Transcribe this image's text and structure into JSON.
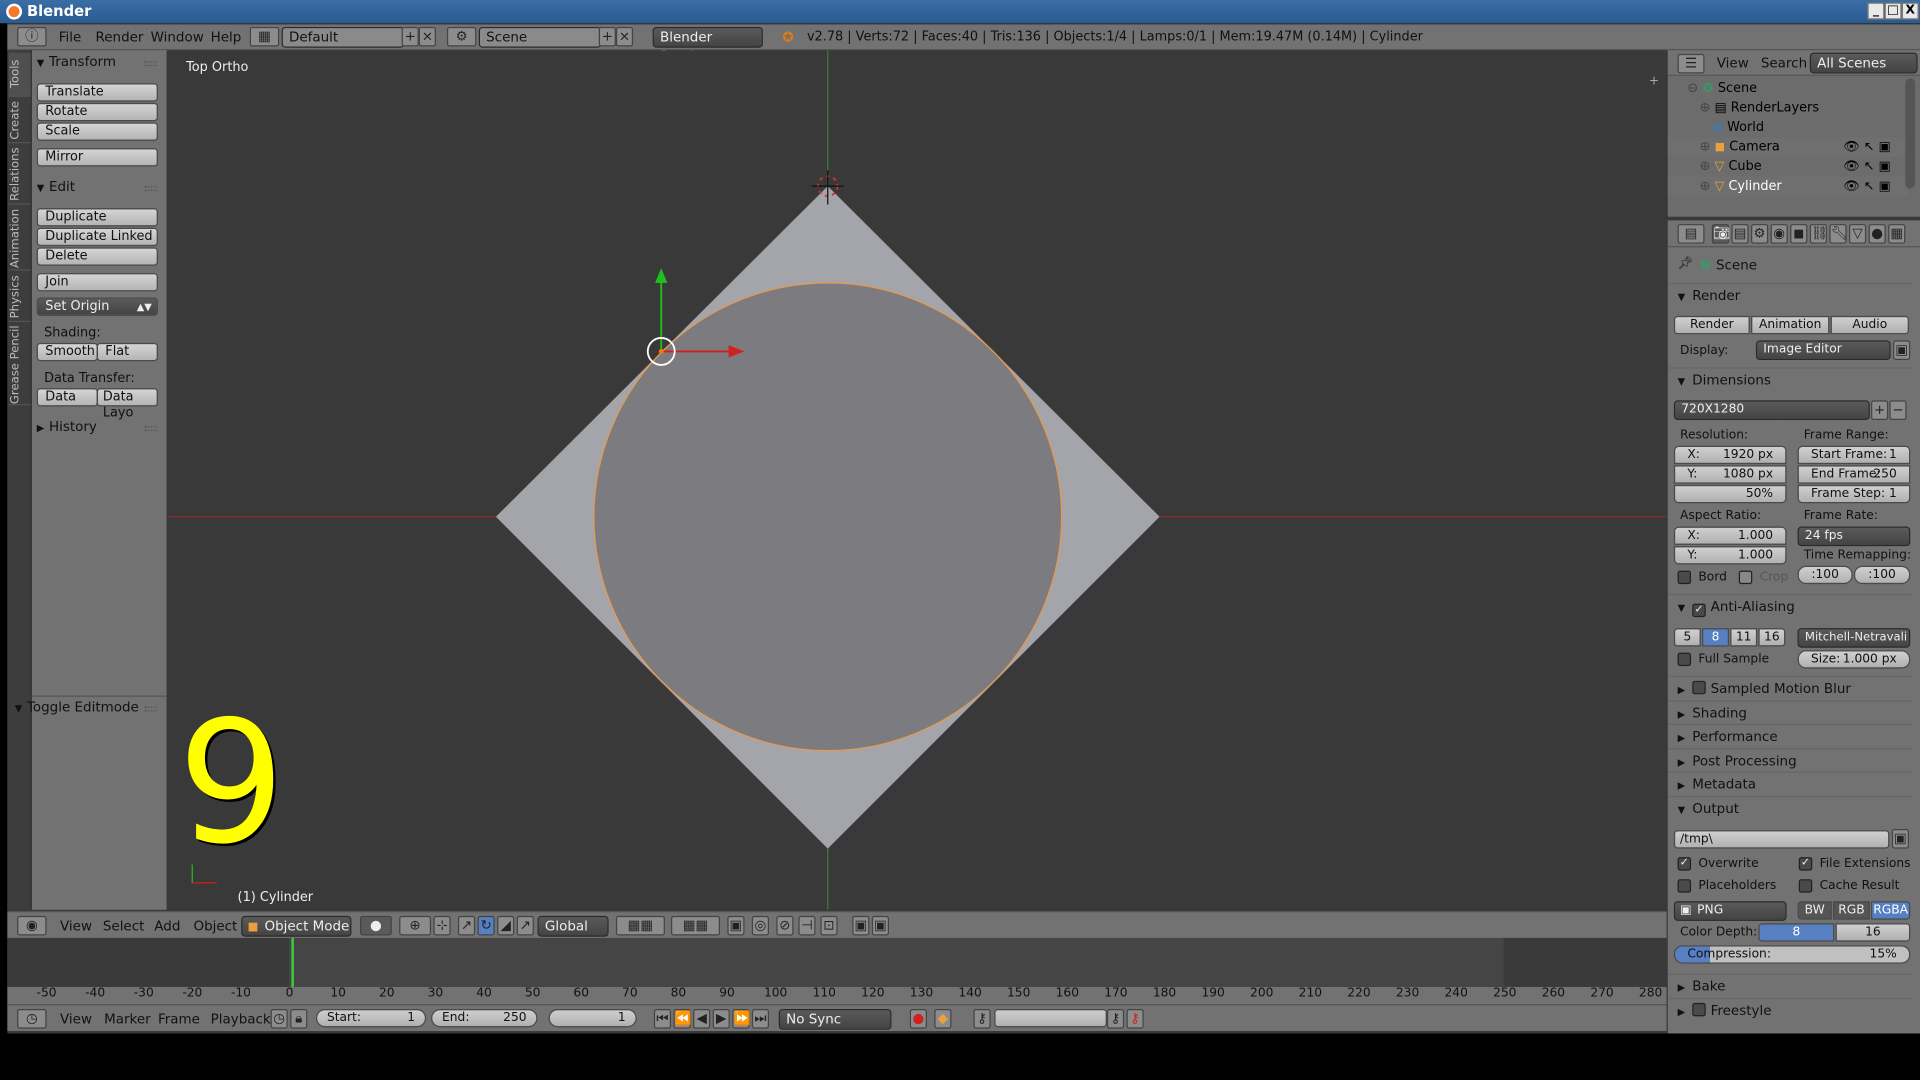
{
  "window": {
    "title": "Blender",
    "min": "_",
    "max": "□",
    "close": "X"
  },
  "menu": {
    "file": "File",
    "render": "Render",
    "window": "Window",
    "help": "Help"
  },
  "header": {
    "layout": "Default",
    "scene": "Scene",
    "engine": "Blender Render",
    "info": "v2.78 | Verts:72 | Faces:40 | Tris:136 | Objects:1/4 | Lamps:0/1 | Mem:19.47M (0.14M) | Cylinder"
  },
  "tabs": [
    "Tools",
    "Create",
    "Relations",
    "Animation",
    "Physics",
    "Grease Pencil"
  ],
  "tools": {
    "transform": "Transform",
    "translate": "Translate",
    "rotate": "Rotate",
    "scale": "Scale",
    "mirror": "Mirror",
    "edit": "Edit",
    "duplicate": "Duplicate",
    "duplicate_linked": "Duplicate Linked",
    "delete": "Delete",
    "join": "Join",
    "set_origin": "Set Origin",
    "shading": "Shading:",
    "smooth": "Smooth",
    "flat": "Flat",
    "data_transfer": "Data Transfer:",
    "data": "Data",
    "data_layo": "Data Layo",
    "history": "History",
    "toggle_editmode": "Toggle Editmode"
  },
  "viewport": {
    "title": "Top Ortho",
    "object": "(1) Cylinder",
    "overlay_digit": "9"
  },
  "vp_header": {
    "view": "View",
    "select": "Select",
    "add": "Add",
    "object": "Object",
    "mode": "Object Mode",
    "orientation": "Global"
  },
  "ruler": [
    "-50",
    "-40",
    "-30",
    "-20",
    "-10",
    "0",
    "10",
    "20",
    "30",
    "40",
    "50",
    "60",
    "70",
    "80",
    "90",
    "100",
    "110",
    "120",
    "130",
    "140",
    "150",
    "160",
    "170",
    "180",
    "190",
    "200",
    "210",
    "220",
    "230",
    "240",
    "250",
    "260",
    "270",
    "280"
  ],
  "timeline": {
    "view": "View",
    "marker": "Marker",
    "frame": "Frame",
    "playback": "Playback",
    "start_label": "Start:",
    "start": "1",
    "end_label": "End:",
    "end": "250",
    "current": "1",
    "sync": "No Sync"
  },
  "outliner": {
    "view": "View",
    "search": "Search",
    "scenes": "All Scenes",
    "items": [
      "Scene",
      "RenderLayers",
      "World",
      "Camera",
      "Cube",
      "Cylinder"
    ]
  },
  "props": {
    "scene": "Scene",
    "render": "Render",
    "btn_render": "Render",
    "btn_animation": "Animation",
    "btn_audio": "Audio",
    "display_label": "Display:",
    "display": "Image Editor",
    "dimensions": "Dimensions",
    "preset": "720X1280",
    "resolution": "Resolution:",
    "res_x_label": "X:",
    "res_x": "1920 px",
    "res_y_label": "Y:",
    "res_y": "1080 px",
    "res_pct": "50%",
    "frame_range": "Frame Range:",
    "start_frame_label": "Start Frame:",
    "start_frame": "1",
    "end_frame_label": "End Frame:",
    "end_frame": "250",
    "frame_step_label": "Frame Step:",
    "frame_step": "1",
    "aspect": "Aspect Ratio:",
    "asp_x_label": "X:",
    "asp_x": "1.000",
    "asp_y_label": "Y:",
    "asp_y": "1.000",
    "frame_rate": "Frame Rate:",
    "fps": "24 fps",
    "time_remap": "Time Remapping:",
    "remap_old": ":100",
    "remap_new": ":100",
    "bord": "Bord",
    "crop": "Crop",
    "aa": "Anti-Aliasing",
    "aa_5": "5",
    "aa_8": "8",
    "aa_11": "11",
    "aa_16": "16",
    "aa_filter": "Mitchell-Netravali",
    "full_sample": "Full Sample",
    "size_label": "Size:",
    "size": "1.000 px",
    "motion_blur": "Sampled Motion Blur",
    "shading": "Shading",
    "performance": "Performance",
    "post": "Post Processing",
    "metadata": "Metadata",
    "output": "Output",
    "path": "/tmp\\",
    "overwrite": "Overwrite",
    "file_ext": "File Extensions",
    "placeholders": "Placeholders",
    "cache": "Cache Result",
    "format": "PNG",
    "bw": "BW",
    "rgb": "RGB",
    "rgba": "RGBA",
    "depth_label": "Color Depth:",
    "depth_8": "8",
    "depth_16": "16",
    "compression_label": "Compression:",
    "compression": "15%",
    "bake": "Bake",
    "freestyle": "Freestyle"
  }
}
